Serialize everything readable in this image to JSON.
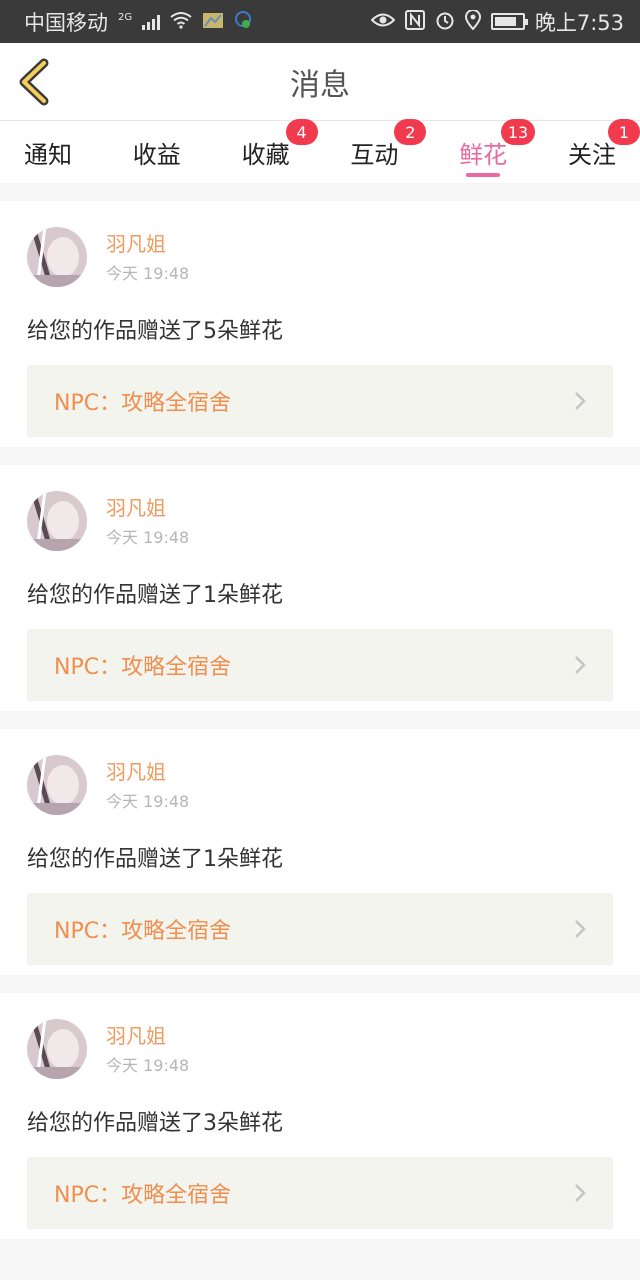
{
  "status_bar": {
    "carrier": "中国移动",
    "network": "2G",
    "time": "晚上7:53"
  },
  "header": {
    "title": "消息"
  },
  "tabs": [
    {
      "label": "通知",
      "badge": ""
    },
    {
      "label": "收益",
      "badge": ""
    },
    {
      "label": "收藏",
      "badge": "4"
    },
    {
      "label": "互动",
      "badge": "2"
    },
    {
      "label": "鲜花",
      "badge": "13"
    },
    {
      "label": "关注",
      "badge": "1"
    }
  ],
  "active_tab": "鲜花",
  "messages": [
    {
      "username": "羽凡姐",
      "time": "今天 19:48",
      "text": "给您的作品赠送了5朵鲜花",
      "link": "NPC：攻略全宿舍"
    },
    {
      "username": "羽凡姐",
      "time": "今天 19:48",
      "text": "给您的作品赠送了1朵鲜花",
      "link": "NPC：攻略全宿舍"
    },
    {
      "username": "羽凡姐",
      "time": "今天 19:48",
      "text": "给您的作品赠送了1朵鲜花",
      "link": "NPC：攻略全宿舍"
    },
    {
      "username": "羽凡姐",
      "time": "今天 19:48",
      "text": "给您的作品赠送了3朵鲜花",
      "link": "NPC：攻略全宿舍"
    }
  ],
  "colors": {
    "accent_pink": "#e86aa0",
    "badge_red": "#f23a4f",
    "link_orange": "#ef8f4f",
    "username_orange": "#ef9a5e"
  }
}
